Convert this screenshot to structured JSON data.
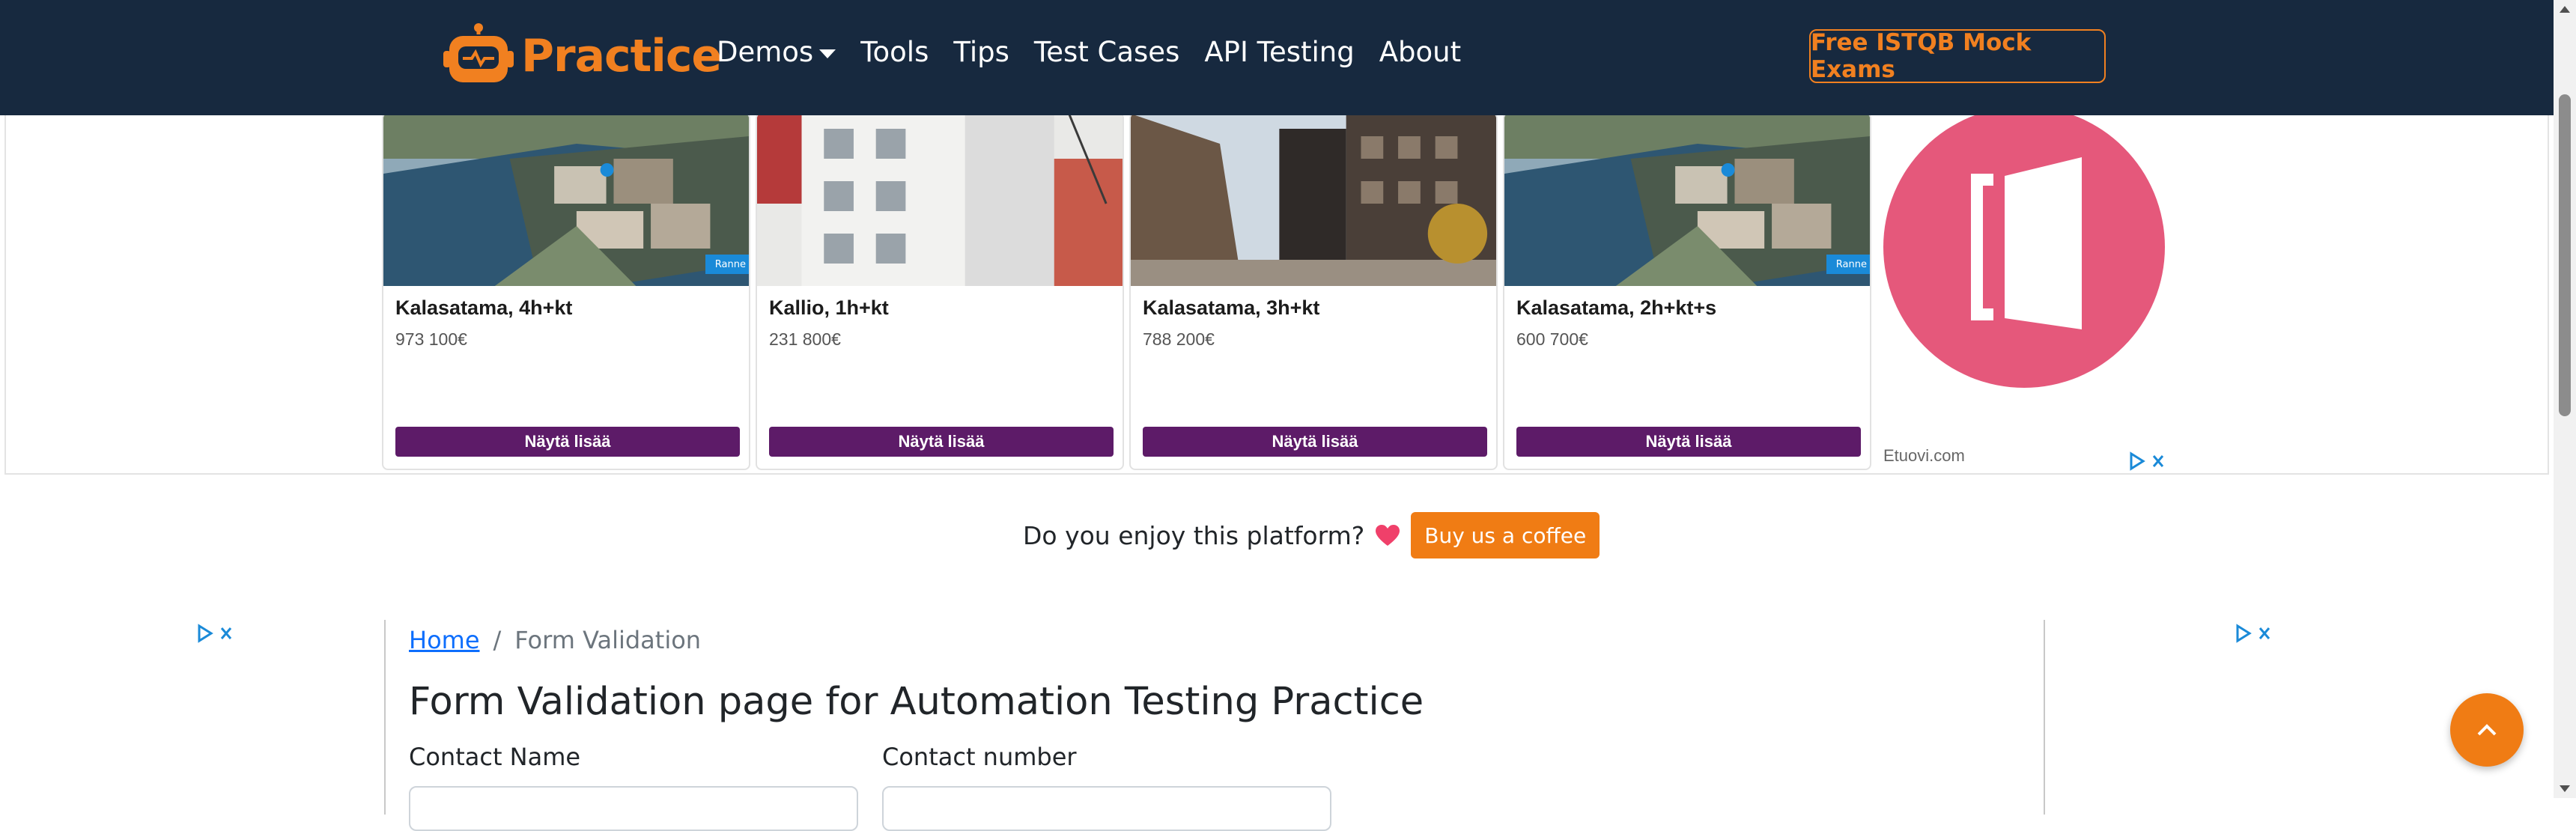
{
  "navbar": {
    "brand": "Practice",
    "links": [
      "Demos",
      "Tools",
      "Tips",
      "Test Cases",
      "API Testing",
      "About"
    ],
    "cta": "Free ISTQB Mock Exams"
  },
  "ad": {
    "listings": [
      {
        "title": "Kalasatama, 4h+kt",
        "price": "973 100€",
        "button": "Näytä lisää",
        "badge": "Ranne"
      },
      {
        "title": "Kallio, 1h+kt",
        "price": "231 800€",
        "button": "Näytä lisää"
      },
      {
        "title": "Kalasatama, 3h+kt",
        "price": "788 200€",
        "button": "Näytä lisää"
      },
      {
        "title": "Kalasatama, 2h+kt+s",
        "price": "600 700€",
        "button": "Näytä lisää",
        "badge": "Ranne"
      }
    ],
    "advertiser": "Etuovi.com"
  },
  "enjoy": {
    "text": "Do you enjoy this platform?",
    "button": "Buy us a coffee"
  },
  "breadcrumb": {
    "home": "Home",
    "separator": "/",
    "current": "Form Validation"
  },
  "page_title": "Form Validation page for Automation Testing Practice",
  "form": {
    "contact_name_label": "Contact Name",
    "contact_number_label": "Contact number"
  },
  "colors": {
    "navbar_bg": "#17293f",
    "accent_orange": "#f18020",
    "listing_button": "#5d1b68",
    "etuovi_pink": "#e5587b"
  }
}
